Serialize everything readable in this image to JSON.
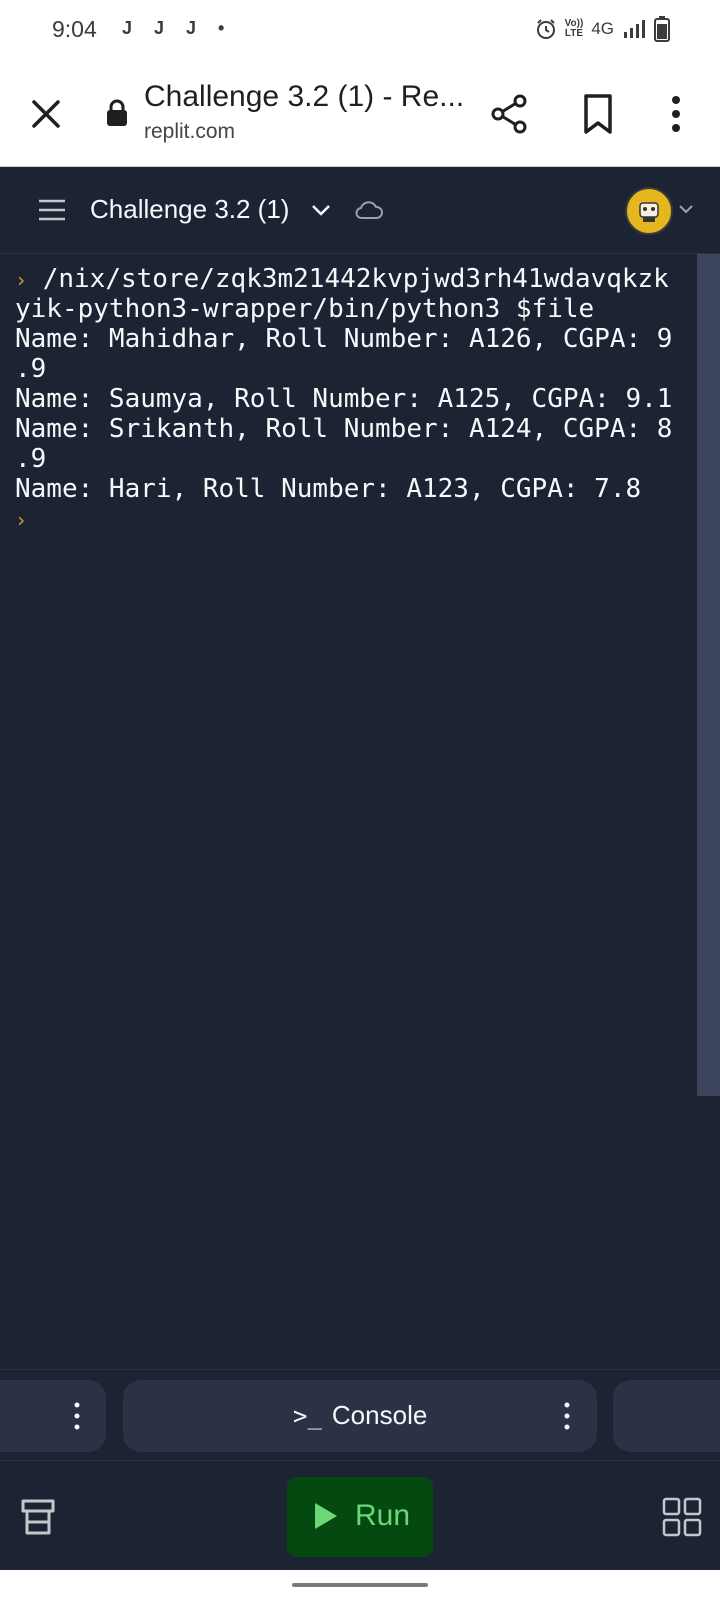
{
  "status_bar": {
    "time": "9:04",
    "notification_icons": [
      "J",
      "J",
      "J",
      "•"
    ],
    "network_label": "4G",
    "lte_top": "Vo))",
    "lte_bottom": "LTE"
  },
  "browser": {
    "title": "Challenge 3.2 (1) - Re...",
    "url": "replit.com"
  },
  "header": {
    "repl_name": "Challenge 3.2 (1)"
  },
  "console": {
    "prompt_path": "/nix/store/zqk3m21442kvpjwd3rh41wdavqkzk",
    "prompt_path_cont": "yik-python3-wrapper/bin/python3 $file",
    "output_lines": [
      "Name: Mahidhar, Roll Number: A126, CGPA: 9",
      ".9",
      "Name: Saumya, Roll Number: A125, CGPA: 9.1",
      "Name: Srikanth, Roll Number: A124, CGPA: 8",
      ".9",
      "Name: Hari, Roll Number: A123, CGPA: 7.8"
    ],
    "prompt_glyph": "›"
  },
  "tabs": {
    "console_glyph": ">_",
    "console_label": "Console"
  },
  "toolbar": {
    "run_label": "Run"
  },
  "colors": {
    "background": "#1c2333",
    "tab_bg": "#2b3245",
    "run_bg": "#044a10",
    "run_fg": "#6ad878",
    "prompt": "#c8a32b",
    "avatar": "#e4b71f"
  }
}
